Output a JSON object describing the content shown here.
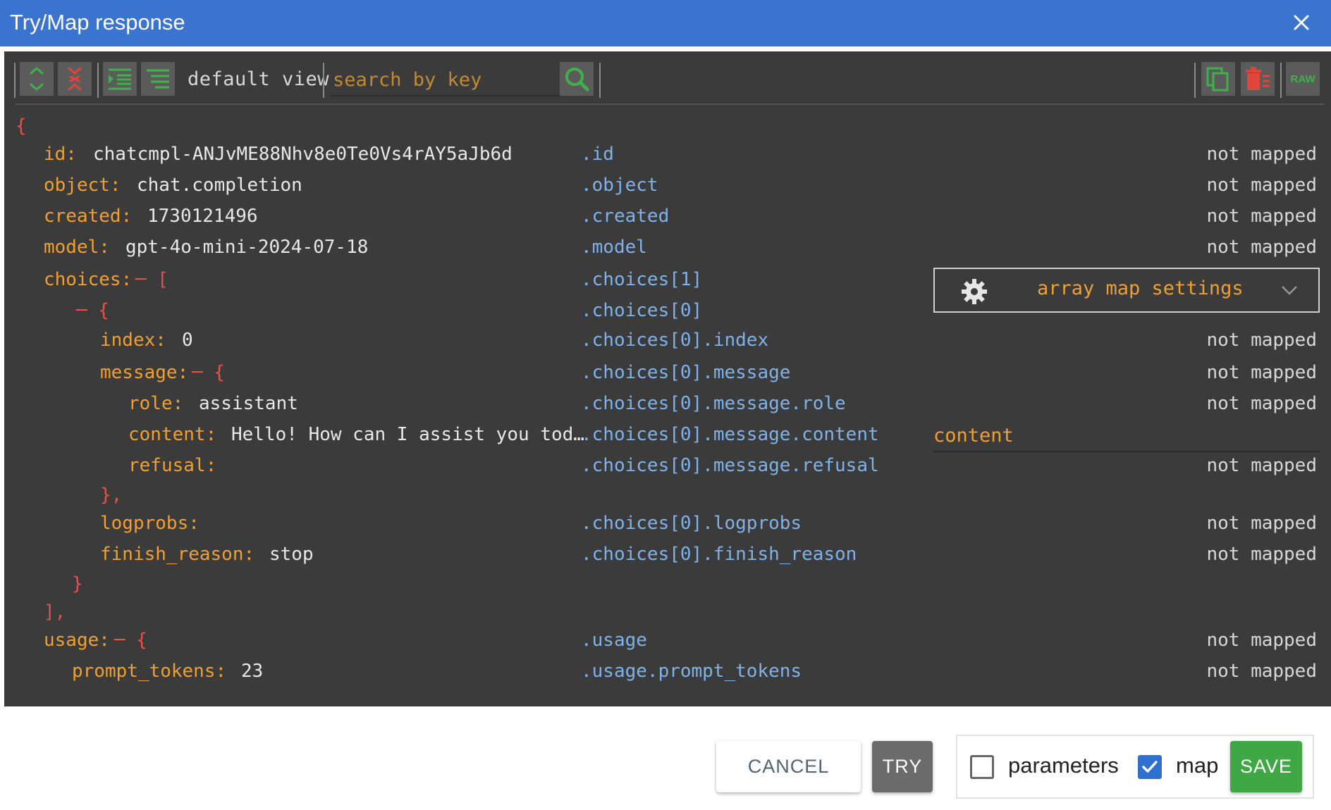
{
  "window": {
    "title": "Try/Map response"
  },
  "toolbar": {
    "default_view_label": "default view",
    "search_placeholder": "search by key",
    "raw_label": "RAW"
  },
  "json_lines": {
    "open_brace": "{",
    "id_key": "id:",
    "id_value": "chatcmpl-ANJvME88Nhv8e0Te0Vs4rAY5aJb6d",
    "id_path": ".id",
    "object_key": "object:",
    "object_value": "chat.completion",
    "object_path": ".object",
    "created_key": "created:",
    "created_value": "1730121496",
    "created_path": ".created",
    "model_key": "model:",
    "model_value": "gpt-4o-mini-2024-07-18",
    "model_path": ".model",
    "choices_key": "choices:",
    "choices_bracket": "─ [",
    "choices_path": ".choices[1]",
    "choice0_bracket": "─ {",
    "choice0_path": ".choices[0]",
    "index_key": "index:",
    "index_value": "0",
    "index_path": ".choices[0].index",
    "message_key": "message:",
    "message_bracket": "─ {",
    "message_path": ".choices[0].message",
    "role_key": "role:",
    "role_value": "assistant",
    "role_path": ".choices[0].message.role",
    "content_key": "content:",
    "content_value": "Hello! How can I assist you tod…",
    "content_path": ".choices[0].message.content",
    "refusal_key": "refusal:",
    "refusal_path": ".choices[0].message.refusal",
    "message_close": "},",
    "logprobs_key": "logprobs:",
    "logprobs_path": ".choices[0].logprobs",
    "finish_key": "finish_reason:",
    "finish_value": "stop",
    "finish_path": ".choices[0].finish_reason",
    "choice0_close": "}",
    "choices_close": "],",
    "usage_key": "usage:",
    "usage_bracket": "─ {",
    "usage_path": ".usage",
    "prompt_tokens_key": "prompt_tokens:",
    "prompt_tokens_value": "23",
    "prompt_tokens_path": ".usage.prompt_tokens"
  },
  "mapping": {
    "not_mapped": "not mapped",
    "array_map_settings": "array map settings",
    "content_mapping": "content"
  },
  "footer": {
    "cancel": "CANCEL",
    "try": "TRY",
    "parameters": "parameters",
    "map": "map",
    "save": "SAVE",
    "parameters_checked": false,
    "map_checked": true
  },
  "colors": {
    "title_bar": "#3a74cf",
    "panel_bg": "#3b3b3b",
    "key": "#f0a030",
    "path": "#7fb2ea",
    "bracket": "#e8504a",
    "save": "#3fa844"
  }
}
